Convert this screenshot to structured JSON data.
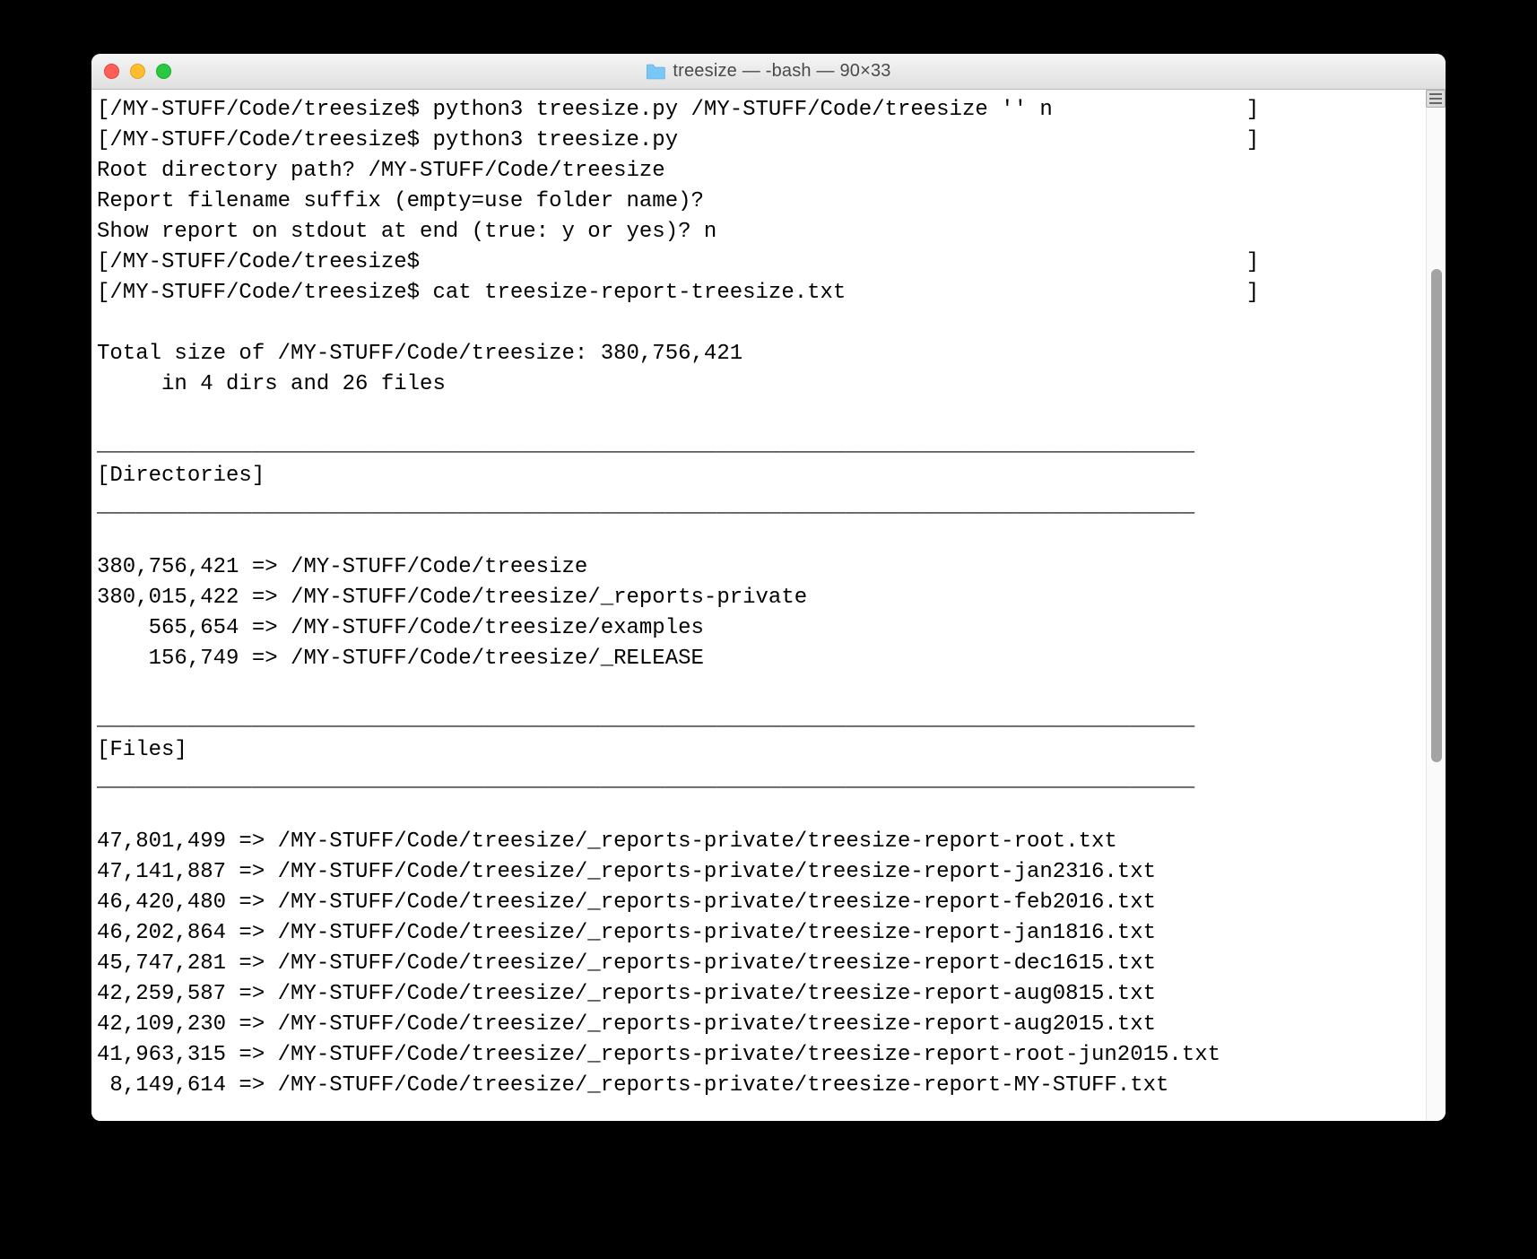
{
  "window": {
    "title": "treesize — -bash — 90×33"
  },
  "terminal": {
    "prompt": "/MY-STUFF/Code/treesize$",
    "cmd1": "python3 treesize.py /MY-STUFF/Code/treesize '' n",
    "cmd2": "python3 treesize.py",
    "q1": "Root directory path? /MY-STUFF/Code/treesize",
    "q2": "Report filename suffix (empty=use folder name)?",
    "q3": "Show report on stdout at end (true: y or yes)? n",
    "cmd3": "cat treesize-report-treesize.txt",
    "total_line": "Total size of /MY-STUFF/Code/treesize: 380,756,421",
    "in_line": "     in 4 dirs and 26 files",
    "sep": "_____________________________________________________________________________________",
    "dir_header": "[Directories]",
    "dirs": [
      {
        "size": "380,756,421",
        "path": "/MY-STUFF/Code/treesize"
      },
      {
        "size": "380,015,422",
        "path": "/MY-STUFF/Code/treesize/_reports-private"
      },
      {
        "size": "    565,654",
        "path": "/MY-STUFF/Code/treesize/examples"
      },
      {
        "size": "    156,749",
        "path": "/MY-STUFF/Code/treesize/_RELEASE"
      }
    ],
    "files_header": "[Files]",
    "files": [
      {
        "size": "47,801,499",
        "path": "/MY-STUFF/Code/treesize/_reports-private/treesize-report-root.txt"
      },
      {
        "size": "47,141,887",
        "path": "/MY-STUFF/Code/treesize/_reports-private/treesize-report-jan2316.txt"
      },
      {
        "size": "46,420,480",
        "path": "/MY-STUFF/Code/treesize/_reports-private/treesize-report-feb2016.txt"
      },
      {
        "size": "46,202,864",
        "path": "/MY-STUFF/Code/treesize/_reports-private/treesize-report-jan1816.txt"
      },
      {
        "size": "45,747,281",
        "path": "/MY-STUFF/Code/treesize/_reports-private/treesize-report-dec1615.txt"
      },
      {
        "size": "42,259,587",
        "path": "/MY-STUFF/Code/treesize/_reports-private/treesize-report-aug0815.txt"
      },
      {
        "size": "42,109,230",
        "path": "/MY-STUFF/Code/treesize/_reports-private/treesize-report-aug2015.txt"
      },
      {
        "size": "41,963,315",
        "path": "/MY-STUFF/Code/treesize/_reports-private/treesize-report-root-jun2015.txt"
      },
      {
        "size": " 8,149,614",
        "path": "/MY-STUFF/Code/treesize/_reports-private/treesize-report-MY-STUFF.txt"
      }
    ]
  }
}
